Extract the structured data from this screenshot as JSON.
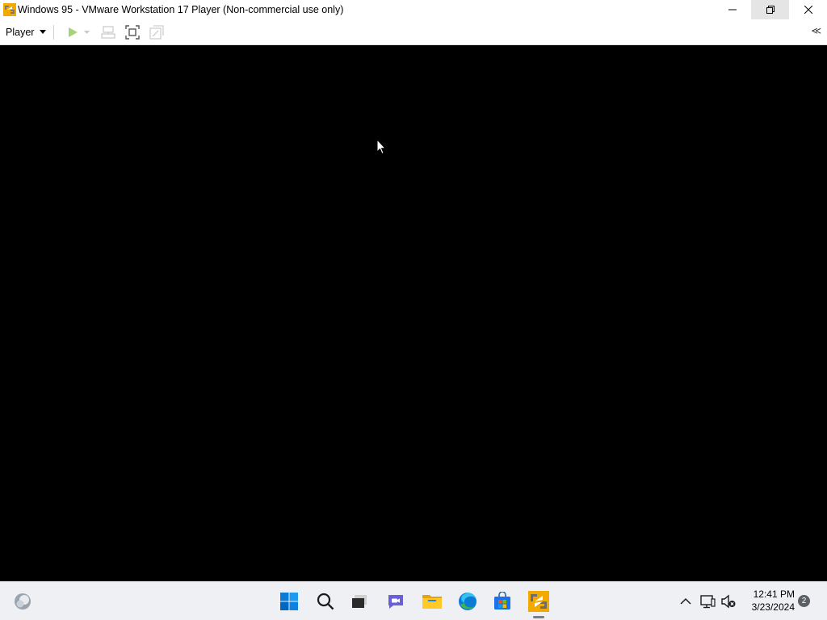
{
  "window": {
    "title": "Windows 95 - VMware Workstation 17 Player (Non-commercial use only)"
  },
  "toolbar": {
    "player_label": "Player",
    "collapse_label": "≪"
  },
  "taskbar": {
    "pinned": [
      "widgets-icon",
      "start-icon",
      "search-icon",
      "task-view-icon",
      "teams-chat-icon",
      "file-explorer-icon",
      "edge-icon",
      "store-icon",
      "vmware-icon"
    ],
    "active_app": "vmware-icon"
  },
  "tray": {
    "time": "12:41 PM",
    "date": "3/23/2024",
    "notification_count": "2"
  },
  "colors": {
    "vmware_orange": "#f2a900",
    "play_green": "#8bc34a",
    "vm_background": "#000000",
    "taskbar_bg": "#eef0f4"
  }
}
